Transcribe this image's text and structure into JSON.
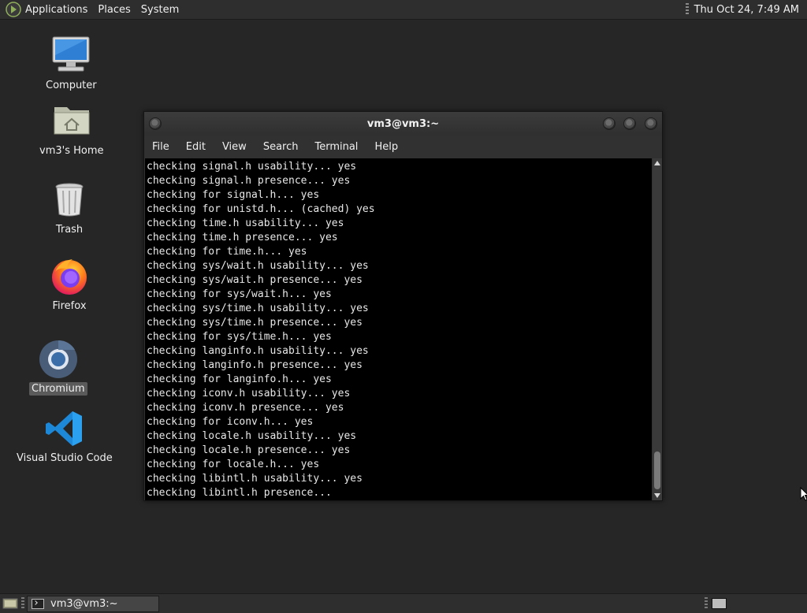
{
  "top_panel": {
    "menus": [
      "Applications",
      "Places",
      "System"
    ],
    "clock": "Thu Oct 24,  7:49 AM"
  },
  "desktop": {
    "icons": [
      {
        "label": "Computer",
        "icon": "computer-icon"
      },
      {
        "label": "vm3's Home",
        "icon": "home-folder-icon"
      },
      {
        "label": "Trash",
        "icon": "trash-icon"
      },
      {
        "label": "Firefox",
        "icon": "firefox-icon"
      },
      {
        "label": "Chromium",
        "icon": "chromium-icon",
        "selected": true
      },
      {
        "label": "Visual Studio Code",
        "icon": "vscode-icon"
      }
    ]
  },
  "terminal": {
    "title": "vm3@vm3:~",
    "menu": [
      "File",
      "Edit",
      "View",
      "Search",
      "Terminal",
      "Help"
    ],
    "lines": [
      "checking signal.h usability... yes",
      "checking signal.h presence... yes",
      "checking for signal.h... yes",
      "checking for unistd.h... (cached) yes",
      "checking time.h usability... yes",
      "checking time.h presence... yes",
      "checking for time.h... yes",
      "checking sys/wait.h usability... yes",
      "checking sys/wait.h presence... yes",
      "checking for sys/wait.h... yes",
      "checking sys/time.h usability... yes",
      "checking sys/time.h presence... yes",
      "checking for sys/time.h... yes",
      "checking langinfo.h usability... yes",
      "checking langinfo.h presence... yes",
      "checking for langinfo.h... yes",
      "checking iconv.h usability... yes",
      "checking iconv.h presence... yes",
      "checking for iconv.h... yes",
      "checking locale.h usability... yes",
      "checking locale.h presence... yes",
      "checking for locale.h... yes",
      "checking libintl.h usability... yes",
      "checking libintl.h presence..."
    ]
  },
  "bottom_panel": {
    "task_label": "vm3@vm3:~"
  },
  "colors": {
    "desktop_bg": "#262626",
    "panel_bg": "#2e2e2e",
    "terminal_bg": "#000000",
    "vscode_blue": "#1e88d8",
    "firefox_orange": "#ff7a1a"
  }
}
